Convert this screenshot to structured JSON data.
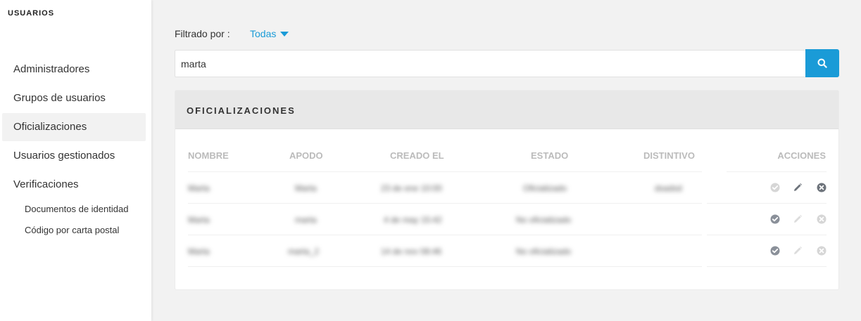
{
  "sidebar": {
    "title": "USUARIOS",
    "items": [
      {
        "label": "Administradores"
      },
      {
        "label": "Grupos de usuarios"
      },
      {
        "label": "Oficializaciones"
      },
      {
        "label": "Usuarios gestionados"
      },
      {
        "label": "Verificaciones"
      }
    ],
    "subitems": [
      {
        "label": "Documentos de identidad"
      },
      {
        "label": "Código por carta postal"
      }
    ]
  },
  "filter": {
    "label": "Filtrado por :",
    "selected": "Todas"
  },
  "search": {
    "value": "marta"
  },
  "panel": {
    "title": "OFICIALIZACIONES",
    "columns": [
      "NOMBRE",
      "APODO",
      "CREADO EL",
      "ESTADO",
      "DISTINTIVO",
      "ACCIONES"
    ],
    "rows": [
      {
        "nombre": "Marta",
        "apodo": "Marta",
        "creado": "23 de ene 10:00",
        "estado": "Oficializado",
        "distintivo": "dsadsd"
      },
      {
        "nombre": "Marta",
        "apodo": "marta",
        "creado": "4 de may 15:42",
        "estado": "No oficializado",
        "distintivo": ""
      },
      {
        "nombre": "Marta",
        "apodo": "marta_2",
        "creado": "14 de nov 08:46",
        "estado": "No oficializado",
        "distintivo": ""
      }
    ]
  },
  "colors": {
    "accent": "#1a9bd7",
    "icon_active": "#8a9099",
    "icon_disabled": "#d6d6d6"
  },
  "icons": [
    "search-icon",
    "caret-down-icon",
    "check-circle-icon",
    "pencil-icon",
    "close-circle-icon"
  ]
}
